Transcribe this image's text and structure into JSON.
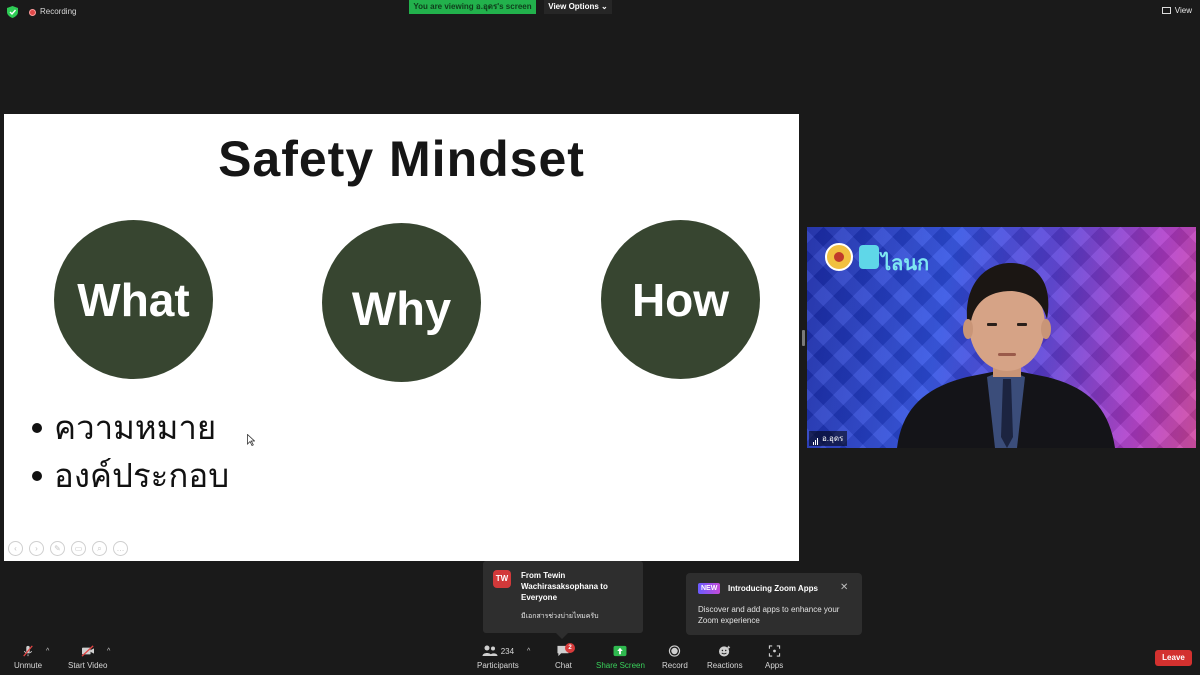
{
  "topbar": {
    "recording_label": "Recording",
    "viewing_banner": "You are viewing อ.อุดร's screen",
    "view_options_label": "View Options",
    "view_label": "View"
  },
  "slide": {
    "title": "Safety Mindset",
    "circles": [
      "What",
      "Why",
      "How"
    ],
    "bullets": [
      "ความหมาย",
      "องค์ประกอบ"
    ],
    "circle_color": "#374530"
  },
  "video": {
    "participant_name": "อ.อุดร",
    "logo_text": "ไลนก"
  },
  "chat_notification": {
    "avatar_initials": "TW",
    "from": "From Tewin Wachirasaksophana to Everyone",
    "message": "มีเอกสารช่วงบ่ายไหมครับ"
  },
  "apps_notification": {
    "badge": "NEW",
    "title": "Introducing Zoom Apps",
    "body": "Discover and add apps to enhance your Zoom experience"
  },
  "toolbar": {
    "unmute": "Unmute",
    "start_video": "Start Video",
    "participants": "Participants",
    "participants_count": "234",
    "chat": "Chat",
    "chat_badge": "2",
    "share_screen": "Share Screen",
    "record": "Record",
    "reactions": "Reactions",
    "apps": "Apps",
    "leave": "Leave"
  },
  "colors": {
    "accent_green": "#22b14c",
    "leave_red": "#d3312f",
    "background": "#1a1a1a"
  }
}
